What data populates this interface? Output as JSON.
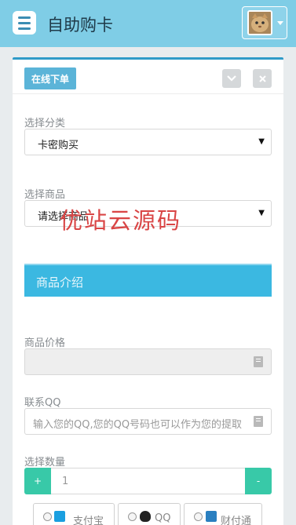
{
  "header": {
    "title": "自助购卡",
    "avatar_alt": "cat avatar"
  },
  "panel": {
    "order_button": "在线下单",
    "collapse_icon": "chevron-down-icon",
    "close_icon": "close-icon"
  },
  "form": {
    "category_label": "选择分类",
    "category_value": "卡密购买",
    "product_label": "选择商品",
    "product_value": "请选择商品",
    "intro_title": "商品介绍",
    "price_label": "商品价格",
    "price_value": "",
    "qq_label": "联系QQ",
    "qq_placeholder": "输入您的QQ,您的QQ号码也可以作为您的提取",
    "qty_label": "选择数量",
    "qty_plus": "+",
    "qty_minus": "-",
    "qty_value": "1"
  },
  "payment": [
    {
      "label": "支付宝",
      "logo_color": "#1a9fe0"
    },
    {
      "label": "QQ",
      "logo_color": "#222222"
    },
    {
      "label": "财付通",
      "logo_color": "#2a7fc0"
    }
  ],
  "watermark": "优站云源码",
  "colors": {
    "topbar": "#7fcde6",
    "accent": "#2f9bc8",
    "intro": "#3bb8e1",
    "stepper": "#38c9a8",
    "watermark": "#d94545"
  }
}
